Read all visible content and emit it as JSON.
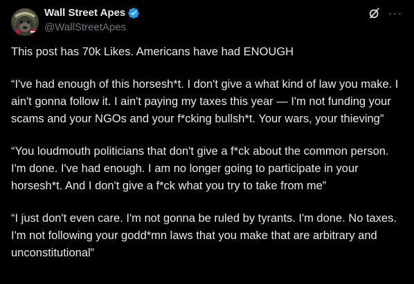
{
  "author": {
    "display_name": "Wall Street Apes",
    "handle": "@WallStreetApes",
    "verified": true,
    "avatar_icon": "gorilla-avatar-icon"
  },
  "actions": {
    "grok_icon": "grok-icon",
    "more_label": "···"
  },
  "post": {
    "paragraphs": [
      "This post has 70k Likes. Americans have had ENOUGH",
      "“I've had enough of this horsesh*t. I don't give a what kind of law you make. I ain't gonna follow it. I ain't paying my taxes this year — I'm not funding your scams and your NGOs and your f*cking bullsh*t. Your wars, your thieving”",
      "“You loudmouth politicians that don't give a f*ck about the common person. I'm done. I've had enough. I am no longer going to participate in your horsesh*t. And I don't give a f*ck what you try to take from me”",
      "“I just don't even care. I'm not gonna be ruled by tyrants. I'm done. No taxes. I'm not following your godd*mn laws that you make that are arbitrary and unconstitutional”"
    ]
  },
  "colors": {
    "background": "#000000",
    "text": "#e7e9ea",
    "secondary": "#71767b",
    "verified_badge": "#1d9bf0"
  }
}
